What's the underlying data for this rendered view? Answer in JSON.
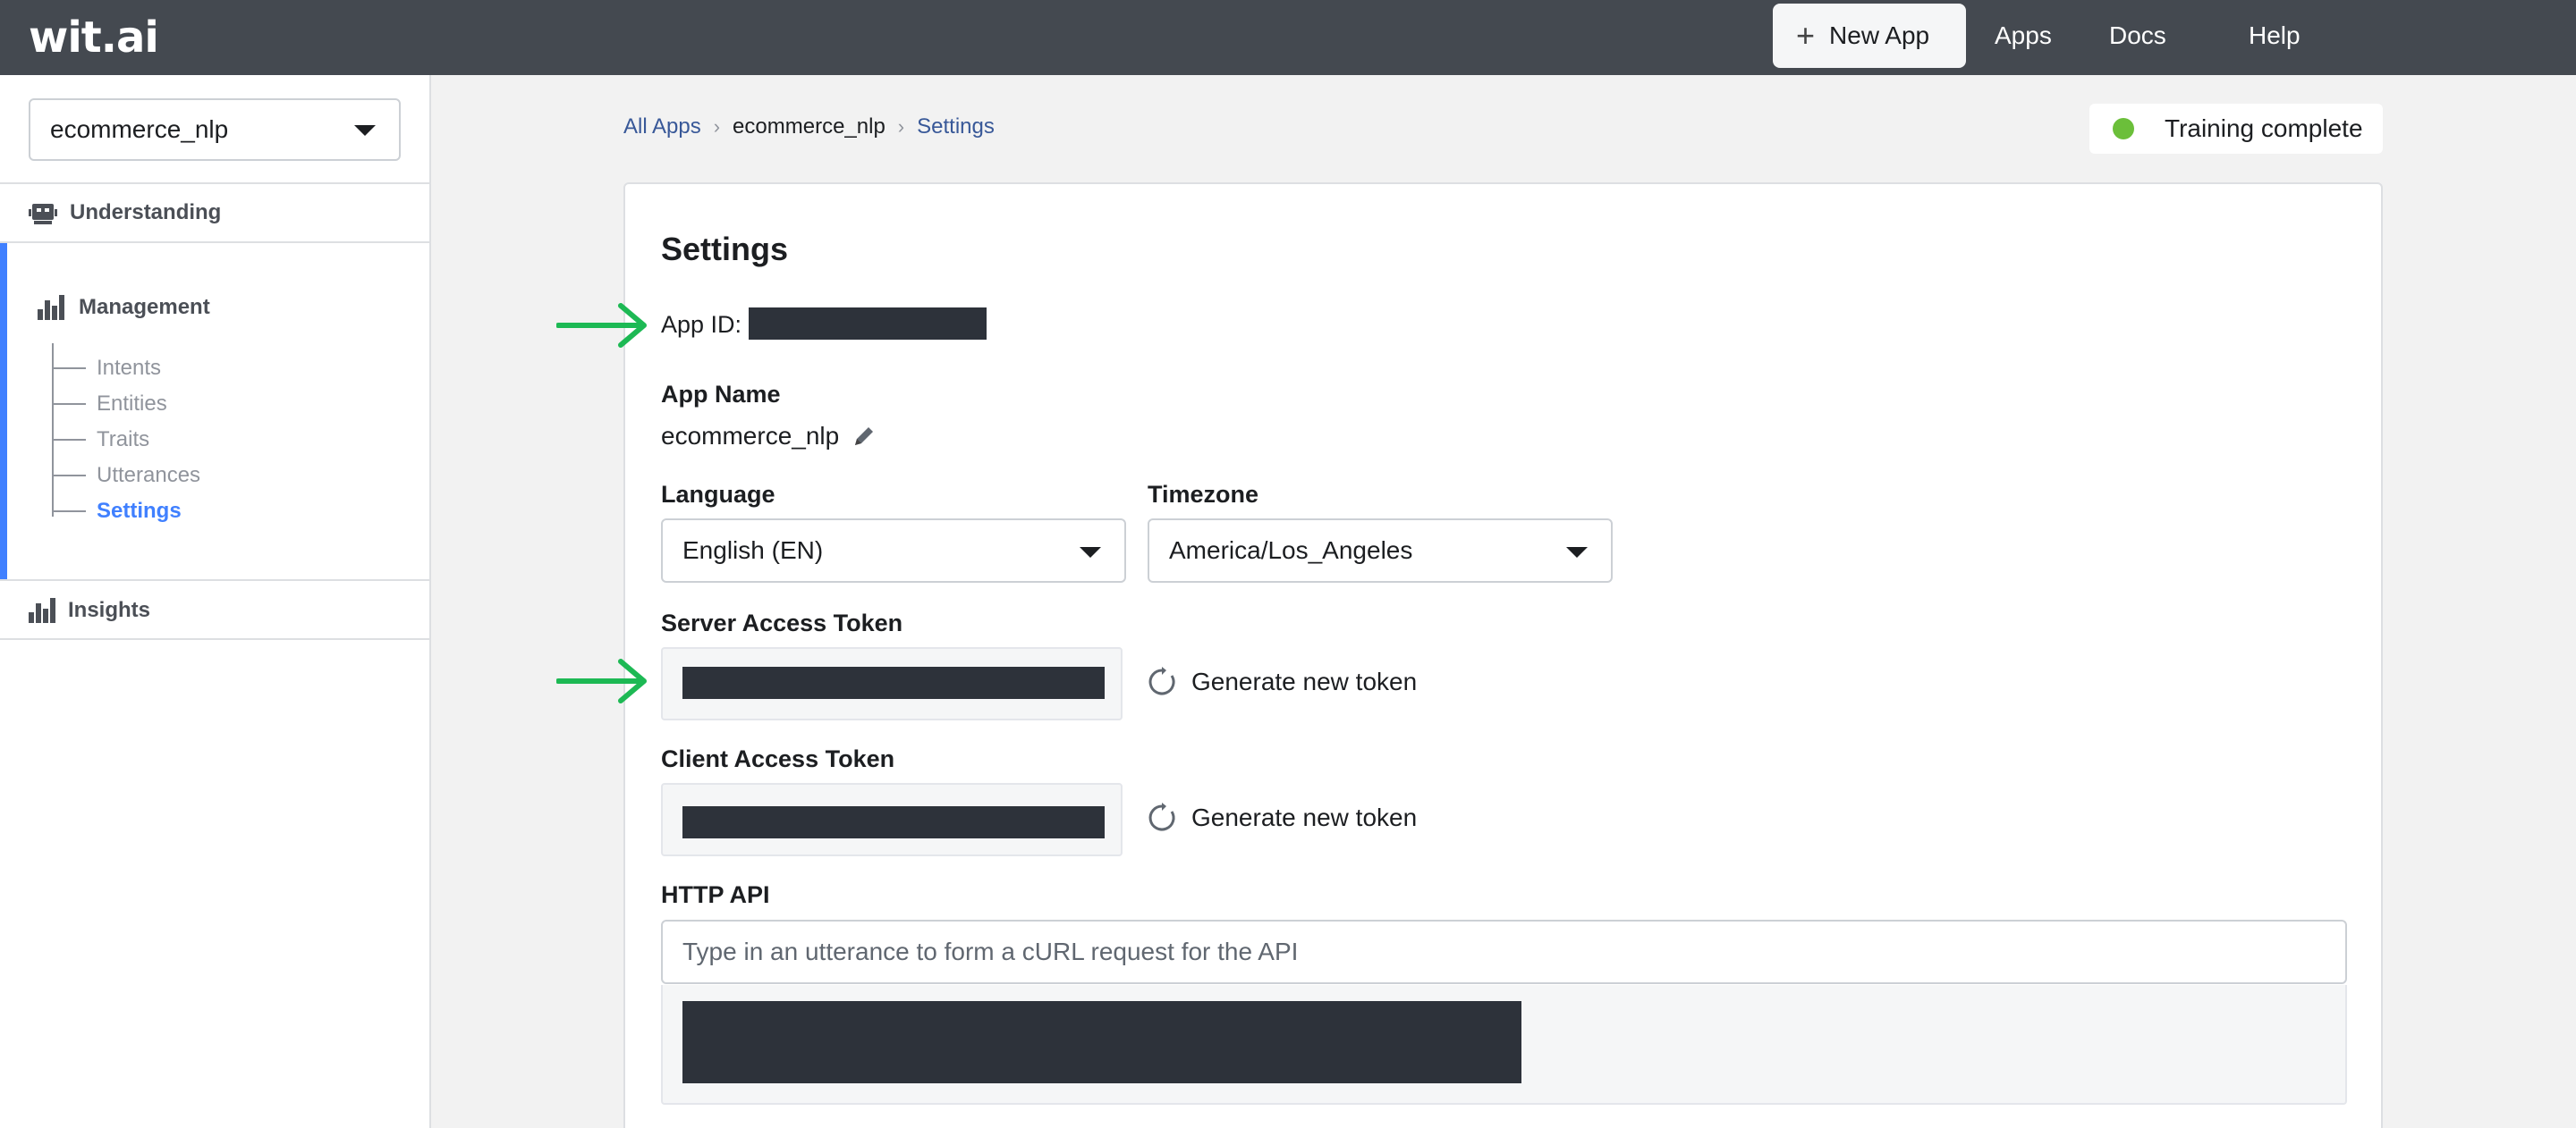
{
  "topbar": {
    "logo": "wit.ai",
    "new_app_label": "New App",
    "nav": {
      "apps": "Apps",
      "docs": "Docs",
      "help": "Help"
    }
  },
  "sidebar": {
    "app_selector": "ecommerce_nlp",
    "sections": {
      "understanding": "Understanding",
      "management": "Management",
      "insights": "Insights"
    },
    "management_items": [
      {
        "label": "Intents"
      },
      {
        "label": "Entities"
      },
      {
        "label": "Traits"
      },
      {
        "label": "Utterances"
      },
      {
        "label": "Settings",
        "active": true
      }
    ]
  },
  "breadcrumb": {
    "all_apps": "All Apps",
    "app": "ecommerce_nlp",
    "current": "Settings"
  },
  "status": {
    "label": "Training complete",
    "color": "#6bbf3a"
  },
  "settings": {
    "title": "Settings",
    "app_id_label": "App ID:",
    "app_name_label": "App Name",
    "app_name_value": "ecommerce_nlp",
    "language_label": "Language",
    "language_value": "English (EN)",
    "timezone_label": "Timezone",
    "timezone_value": "America/Los_Angeles",
    "server_token_label": "Server Access Token",
    "client_token_label": "Client Access Token",
    "generate_label": "Generate new token",
    "http_api_label": "HTTP API",
    "http_api_placeholder": "Type in an utterance to form a cURL request for the API"
  },
  "colors": {
    "accent": "#4080ff",
    "annotation_arrow": "#1db954",
    "redaction": "#2d323a"
  }
}
